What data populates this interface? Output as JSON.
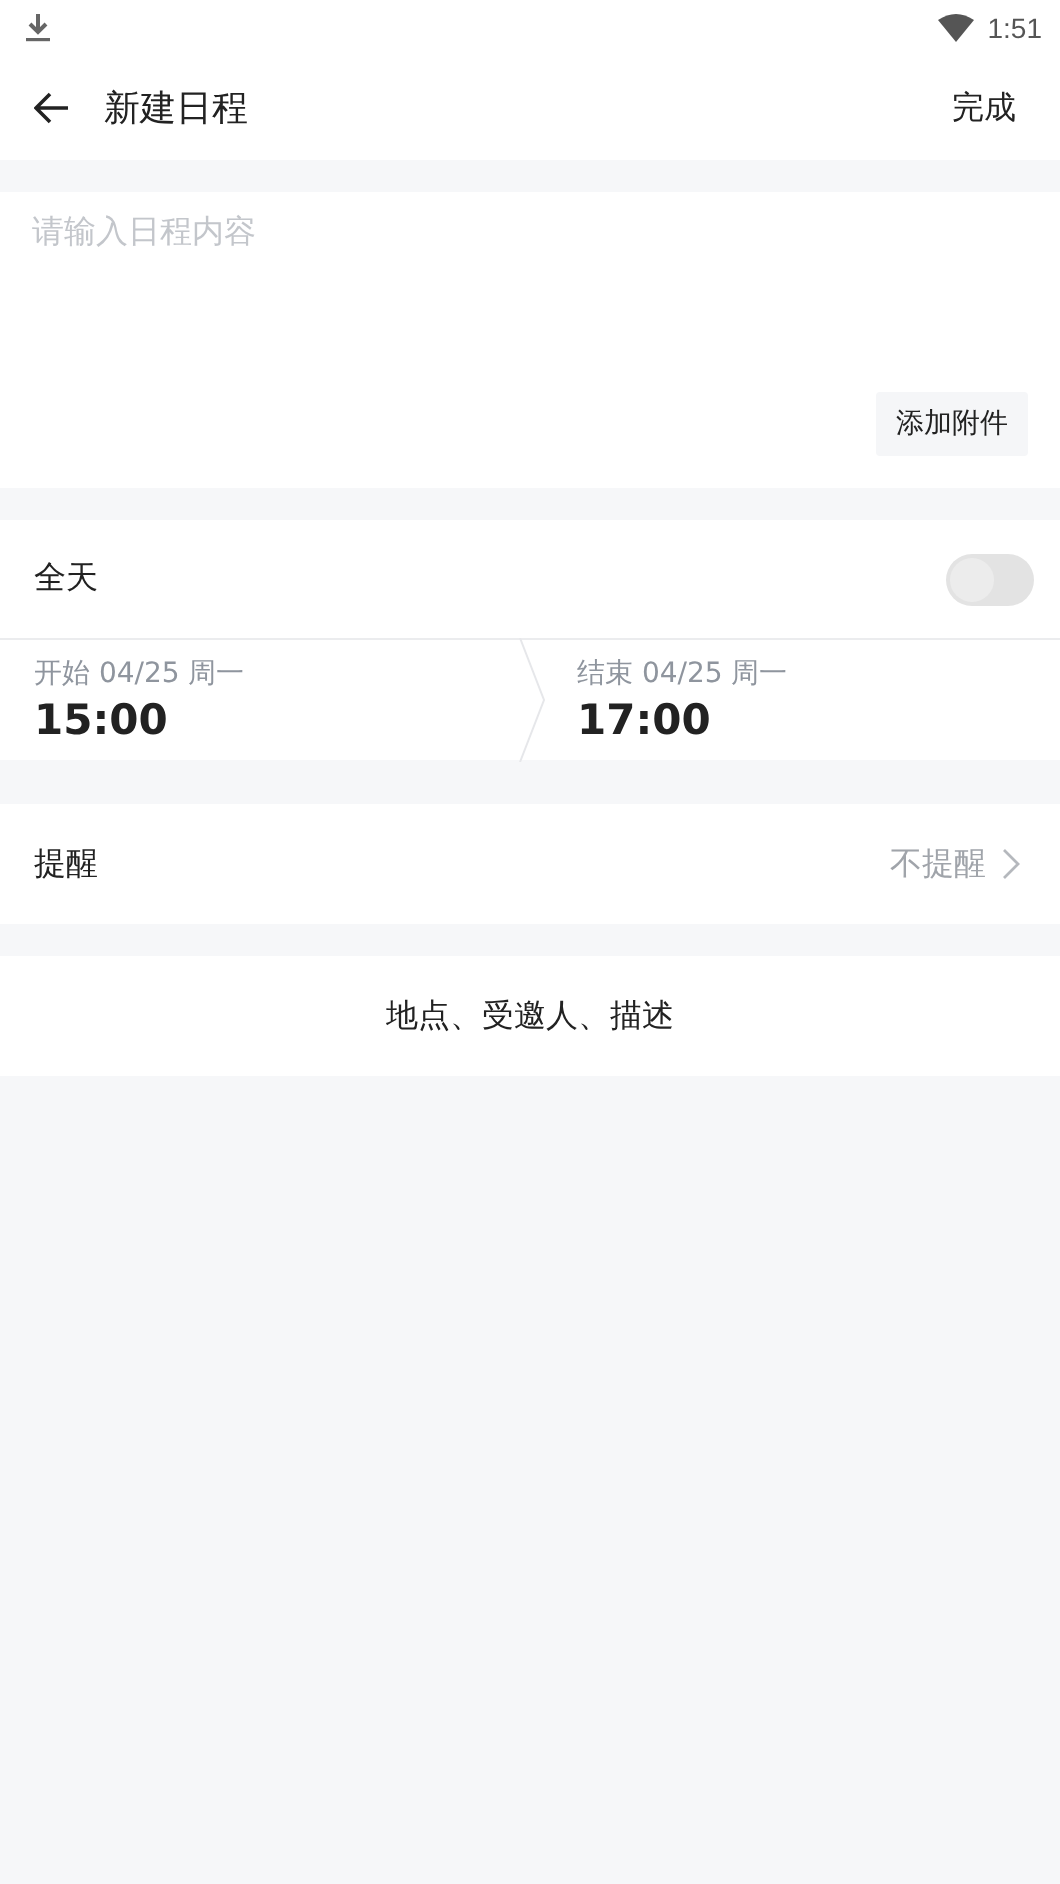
{
  "status_bar": {
    "time": "1:51"
  },
  "header": {
    "title": "新建日程",
    "action": "完成"
  },
  "content": {
    "placeholder": "请输入日程内容",
    "attach_button": "添加附件"
  },
  "all_day": {
    "label": "全天",
    "on": false
  },
  "start": {
    "label": "开始 04/25 周一",
    "time": "15:00"
  },
  "end": {
    "label": "结束 04/25 周一",
    "time": "17:00"
  },
  "reminder": {
    "label": "提醒",
    "value": "不提醒"
  },
  "more": {
    "label": "地点、受邀人、描述"
  }
}
